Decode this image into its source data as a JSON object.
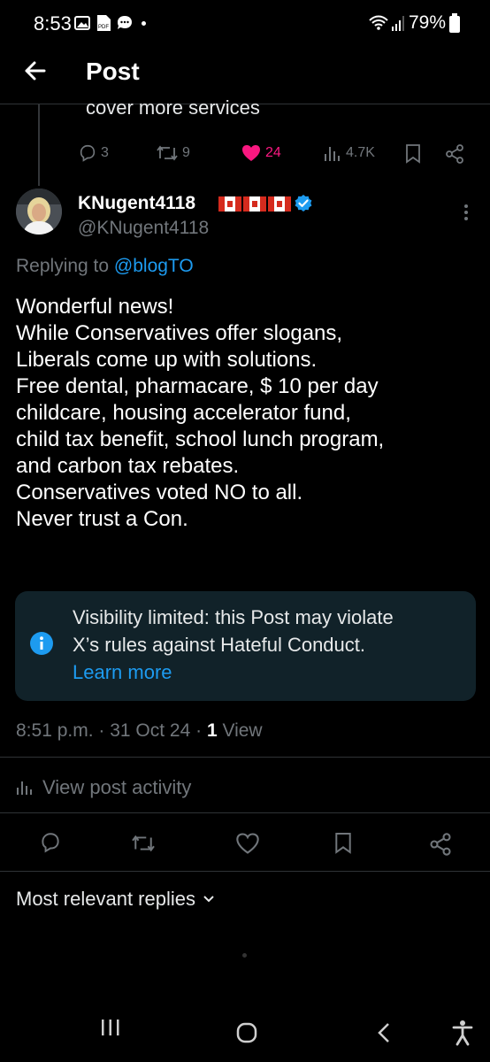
{
  "status_bar": {
    "time": "8:53",
    "battery": "79%",
    "notification_icons": [
      "image-icon",
      "pdf-icon",
      "chat-icon",
      "dot-icon"
    ],
    "system_icons": [
      "wifi-icon",
      "signal-icon",
      "battery-icon"
    ]
  },
  "header": {
    "title": "Post"
  },
  "parent_post": {
    "text_fragment": "cover more services",
    "actions": {
      "replies": "3",
      "reposts": "9",
      "likes": "24",
      "views": "4.7K"
    },
    "like_color": "#f91880"
  },
  "reply": {
    "display_name": "KNugent4118",
    "handle": "@KNugent4118",
    "verified": true,
    "replying_prefix": "Replying to ",
    "replying_to": "@blogTO",
    "body_lines": [
      "Wonderful news!",
      "While Conservatives offer slogans,",
      "Liberals come up with solutions.",
      "Free dental, pharmacare, $ 10 per day",
      "childcare, housing accelerator fund,",
      "child tax benefit, school lunch program,",
      "and carbon tax rebates.",
      "Conservatives voted NO to all.",
      "Never trust a Con."
    ],
    "notice": {
      "line1": "Visibility limited: this Post may violate",
      "line2": "X’s rules against Hateful Conduct.",
      "link": "Learn more"
    },
    "time": "8:51 p.m. · 31 Oct 24 · ",
    "views_count": "1",
    "views_label": " View",
    "activity_label": "View post activity"
  },
  "replies_section": {
    "sort_label": "Most relevant replies"
  },
  "colors": {
    "accent": "#1d9bf0",
    "background": "#000000",
    "muted": "#71767b",
    "notice_bg": "#112229"
  }
}
